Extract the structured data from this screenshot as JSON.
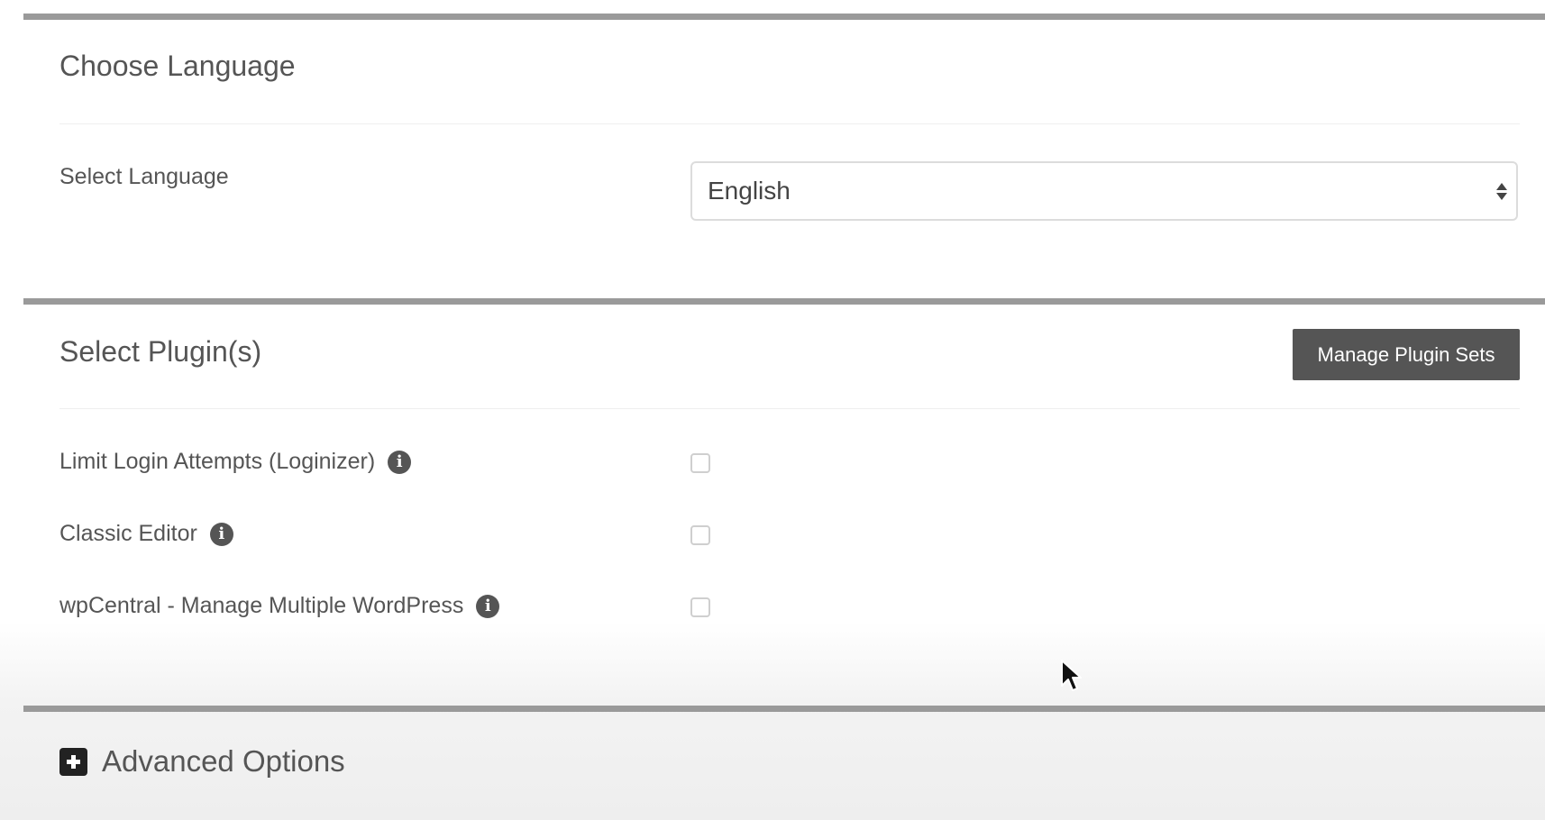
{
  "language_section": {
    "title": "Choose Language",
    "select_label": "Select Language",
    "selected_value": "English"
  },
  "plugins_section": {
    "title": "Select Plugin(s)",
    "manage_button_label": "Manage Plugin Sets",
    "plugins": [
      {
        "label": "Limit Login Attempts (Loginizer)",
        "checked": false
      },
      {
        "label": "Classic Editor",
        "checked": false
      },
      {
        "label": "wpCentral - Manage Multiple WordPress",
        "checked": false
      }
    ]
  },
  "advanced": {
    "label": "Advanced Options",
    "icon": "plus-square-icon"
  },
  "icons": {
    "info": "info-icon"
  },
  "colors": {
    "button_bg": "#555555",
    "divider": "#9a9a9a",
    "text": "#555555"
  }
}
